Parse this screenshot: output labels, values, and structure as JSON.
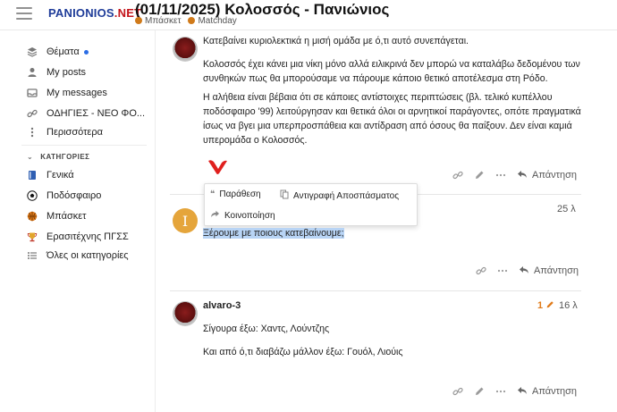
{
  "header": {
    "logo_part1": "PANIONIOS",
    "logo_part2": ".NET",
    "topic_title": "(01/11/2025) Κολοσσός - Πανιώνιος",
    "category": "Μπάσκετ",
    "tag": "Matchday"
  },
  "sidebar": {
    "items": [
      {
        "label": "Θέματα",
        "icon": "layers-icon"
      },
      {
        "label": "My posts",
        "icon": "user-icon"
      },
      {
        "label": "My messages",
        "icon": "inbox-icon"
      },
      {
        "label": "ΟΔΗΓΙΕΣ - ΝΕΟ ΦΟ...",
        "icon": "link-icon"
      },
      {
        "label": "Περισσότερα",
        "icon": "more-icon"
      }
    ],
    "section_title": "ΚΑΤΗΓΟΡΙΕΣ",
    "categories": [
      {
        "label": "Γενικά",
        "icon": "book-icon"
      },
      {
        "label": "Ποδόσφαιρο",
        "icon": "soccer-ball-icon"
      },
      {
        "label": "Μπάσκετ",
        "icon": "basketball-icon"
      },
      {
        "label": "Ερασιτέχνης ΠΓΣΣ",
        "icon": "trophy-icon"
      },
      {
        "label": "Όλες οι κατηγορίες",
        "icon": "list-icon"
      }
    ]
  },
  "posts": [
    {
      "paragraphs": [
        "Κατεβαίνει κυριολεκτικά η μισή ομάδα με ό,τι αυτό συνεπάγεται.",
        "Κολοσσός έχει κάνει μια νίκη μόνο αλλά ειλικρινά δεν μπορώ να καταλάβω δεδομένου των συνθηκών πως θα μπορούσαμε να πάρουμε κάποιο θετικό αποτέλεσμα στη Ρόδο.",
        "Η αλήθεια είναι βέβαια ότι σε κάποιες αντίστοιχες περιπτώσεις (βλ. τελικό κυπέλλου ποδόσφαιρο '99) λειτούργησαν και θετικά όλοι οι αρνητικοί παράγοντες, οπότε πραγματικά ίσως να βγει μια υπερπροσπάθεια και αντίδραση από όσους θα παίξουν. Δεν είναι καμιά υπερομάδα ο Κολοσσός."
      ],
      "reply_label": "Απάντηση"
    },
    {
      "avatar_letter": "I",
      "age": "25 λ",
      "text": "Ξέρουμε με ποιους κατεβαίνουμε;",
      "reply_label": "Απάντηση"
    },
    {
      "username": "alvaro-3",
      "edit_count": "1",
      "age": "16 λ",
      "paragraphs": [
        "Σίγουρα έξω: Χαντς, Λούντζης",
        "Και από ό,τι διαβάζω μάλλον έξω: Γουόλ, Λιούις"
      ],
      "reply_label": "Απάντηση"
    }
  ],
  "popup": {
    "quote_label": "Παράθεση",
    "copy_quote_label": "Αντιγραφή Αποσπάσματος",
    "share_label": "Κοινοποίηση"
  },
  "colors": {
    "logo_blue": "#1f3c99",
    "logo_red": "#c4161c",
    "new_dot": "#2b6de5",
    "selection": "#b8d4f5",
    "edit_orange": "#e07b1a"
  }
}
